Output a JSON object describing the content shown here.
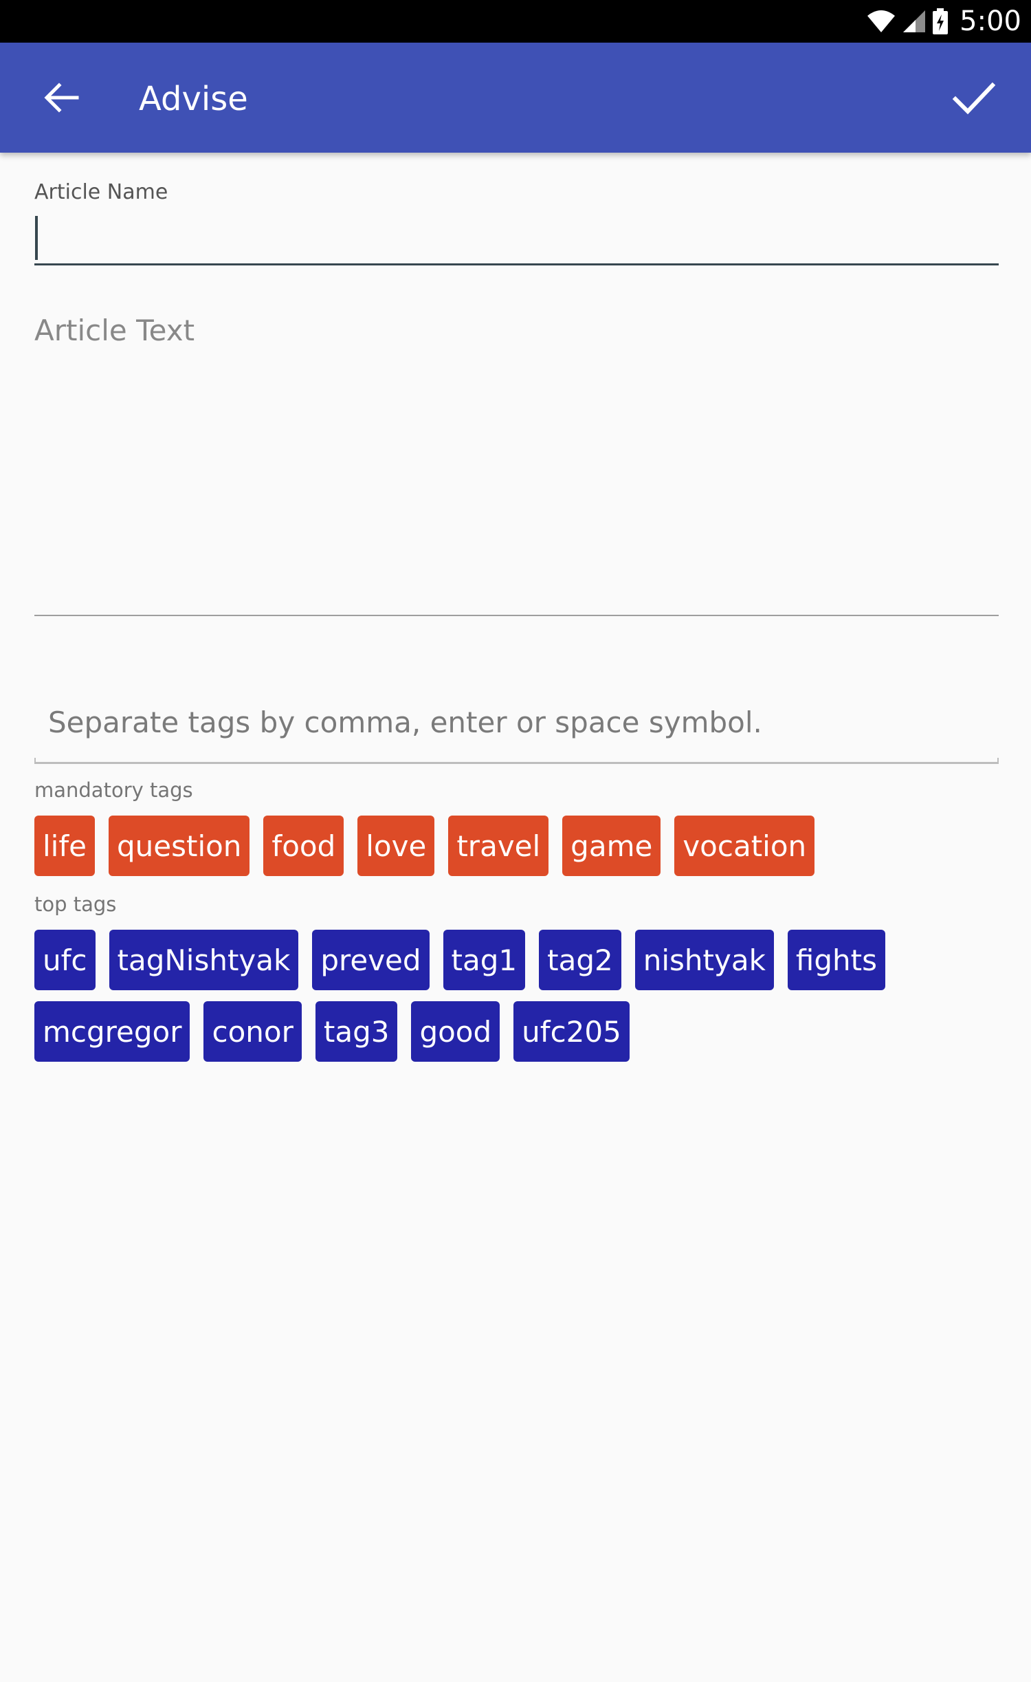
{
  "status_bar": {
    "time": "5:00",
    "icons": [
      "wifi-icon",
      "signal-icon",
      "battery-icon"
    ]
  },
  "app_bar": {
    "title": "Advise",
    "back_icon": "arrow-back-icon",
    "confirm_icon": "check-icon",
    "color": "#3f51b5"
  },
  "form": {
    "article_name_label": "Article Name",
    "article_name_value": "",
    "article_text_placeholder": "Article Text",
    "tags_placeholder": "Separate tags by comma, enter or space symbol."
  },
  "mandatory_tags": {
    "label": "mandatory tags",
    "color": "#dd4b27",
    "items": [
      "life",
      "question",
      "food",
      "love",
      "travel",
      "game",
      "vocation"
    ]
  },
  "top_tags": {
    "label": "top tags",
    "color": "#2424a8",
    "items": [
      "ufc",
      "tagNishtyak",
      "preved",
      "tag1",
      "tag2",
      "nishtyak",
      "fights",
      "mcgregor",
      "conor",
      "tag3",
      "good",
      "ufc205"
    ]
  }
}
